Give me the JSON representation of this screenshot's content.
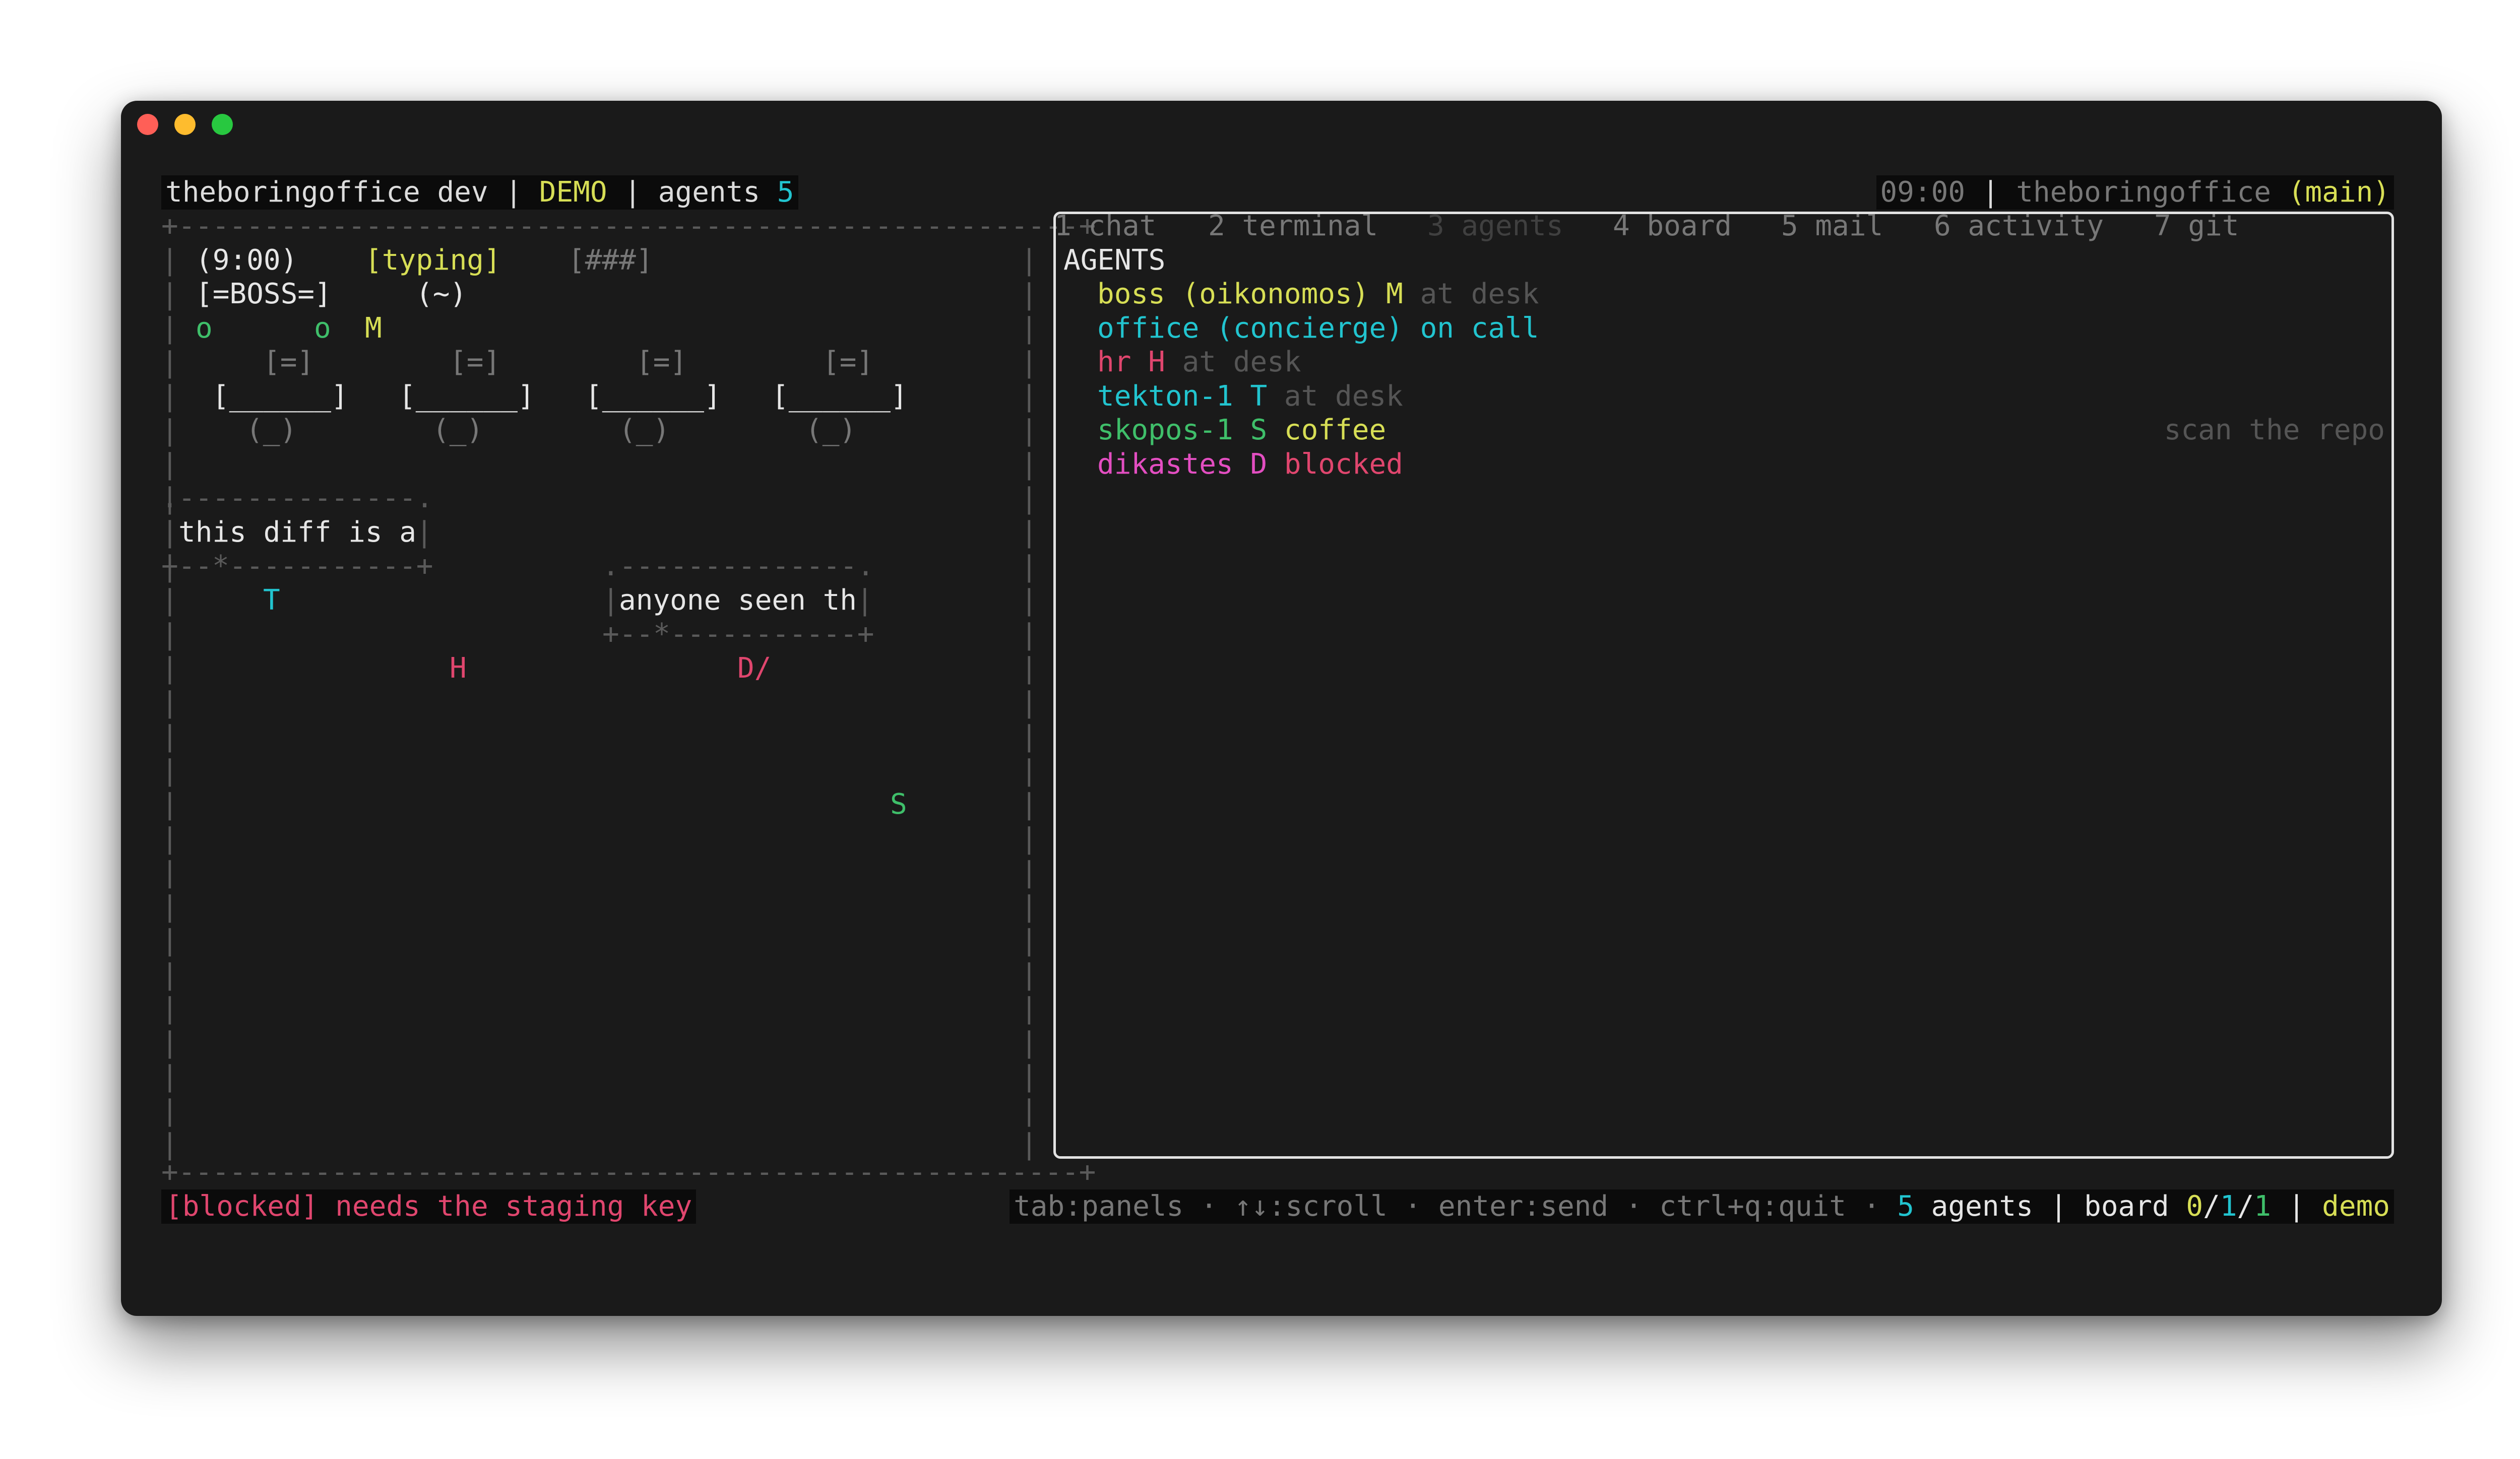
{
  "window": {
    "controls": [
      "close",
      "minimize",
      "zoom"
    ]
  },
  "header": {
    "app": "theboringoffice dev",
    "sep1": " | ",
    "mode": "DEMO",
    "sep2": " | ",
    "agents_label": "agents ",
    "agents_count": "5",
    "clock": "09:00",
    "sep3": " | ",
    "repo": "theboringoffice",
    "branch": "(main)"
  },
  "tabs": [
    {
      "label": "1 chat"
    },
    {
      "label": "2 terminal"
    },
    {
      "label": "3 agents",
      "active": true
    },
    {
      "label": "4 board"
    },
    {
      "label": "5 mail"
    },
    {
      "label": "6 activity"
    },
    {
      "label": "7 git"
    }
  ],
  "office": {
    "clock": "(9:00)",
    "status": "[typing]",
    "progress": "[###]",
    "boss_sign": "[=BOSS=]",
    "boss_face": "(~)",
    "plant1": "o",
    "plant2": "o",
    "boss_marker": "M",
    "monitor": "[=]",
    "desk": "[______]",
    "chair": "(_)",
    "bubble1": "this diff is a",
    "bubble2": "anyone seen th",
    "agents": {
      "T": "T",
      "H": "H",
      "D": "D/",
      "S": "S"
    }
  },
  "agents_panel": {
    "title": "AGENTS",
    "rows": [
      {
        "name": "boss (oikonomos)",
        "code": "M",
        "status": "at desk"
      },
      {
        "name": "office (concierge)",
        "code": "",
        "status": "on call"
      },
      {
        "name": "hr",
        "code": "H",
        "status": "at desk"
      },
      {
        "name": "tekton-1",
        "code": "T",
        "status": "at desk"
      },
      {
        "name": "skopos-1",
        "code": "S",
        "status": "coffee",
        "note": "scan the repo"
      },
      {
        "name": "dikastes",
        "code": "D",
        "status": "blocked"
      }
    ]
  },
  "footer": {
    "alert": "[blocked] needs the staging key",
    "hints": "tab:panels · ↑↓:scroll · enter:send · ctrl+q:quit · ",
    "agents_count": "5",
    "agents_label": " agents | board ",
    "board_a": "0",
    "board_slash1": "/",
    "board_b": "1",
    "board_slash2": "/",
    "board_c": "1",
    "sep": " | ",
    "mode": "demo"
  },
  "colors": {
    "yellow": "#d7de55",
    "cyan": "#22c4cf",
    "red": "#e0466e",
    "green": "#3fbf6a",
    "magenta": "#e34ec1",
    "background": "#1a1a1a"
  }
}
